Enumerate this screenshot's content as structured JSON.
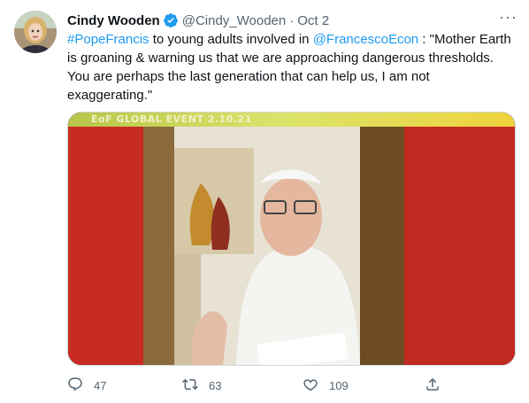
{
  "tweet": {
    "author_name": "Cindy Wooden",
    "handle": "@Cindy_Wooden",
    "separator": "·",
    "date": "Oct 2",
    "more_label": "···",
    "text": {
      "hashtag": "#PopeFrancis",
      "part1": " to young adults involved in ",
      "mention": "@FrancescoEcon",
      "part2": " : \"Mother Earth is groaning & warning us that we are approaching dangerous thresholds. You are perhaps the last generation that can help us, I am not exaggerating.\""
    },
    "media": {
      "banner_text": "EoF GLOBAL EVENT 2.10.21"
    },
    "actions": {
      "replies": "47",
      "retweets": "63",
      "likes": "109"
    }
  },
  "colors": {
    "link": "#1d9bf0",
    "verified": "#1d9bf0",
    "secondary_text": "#536471",
    "media_background": "#b3261e"
  },
  "icons": [
    "verified-badge-icon",
    "more-icon",
    "reply-icon",
    "retweet-icon",
    "like-icon",
    "share-icon"
  ]
}
